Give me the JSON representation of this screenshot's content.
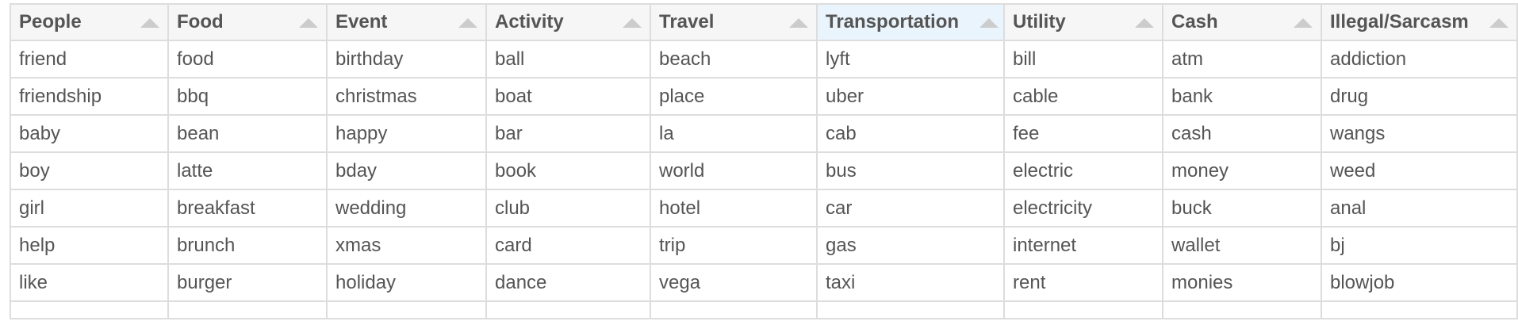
{
  "table": {
    "columns": [
      "People",
      "Food",
      "Event",
      "Activity",
      "Travel",
      "Transportation",
      "Utility",
      "Cash",
      "Illegal/Sarcasm"
    ],
    "active_column": "Transportation",
    "sort_icon": "sort-up-triangle",
    "rows": [
      [
        "friend",
        "food",
        "birthday",
        "ball",
        "beach",
        "lyft",
        "bill",
        "atm",
        "addiction"
      ],
      [
        "friendship",
        "bbq",
        "christmas",
        "boat",
        "place",
        "uber",
        "cable",
        "bank",
        "drug"
      ],
      [
        "baby",
        "bean",
        "happy",
        "bar",
        "la",
        "cab",
        "fee",
        "cash",
        "wangs"
      ],
      [
        "boy",
        "latte",
        "bday",
        "book",
        "world",
        "bus",
        "electric",
        "money",
        "weed"
      ],
      [
        "girl",
        "breakfast",
        "wedding",
        "club",
        "hotel",
        "car",
        "electricity",
        "buck",
        "anal"
      ],
      [
        "help",
        "brunch",
        "xmas",
        "card",
        "trip",
        "gas",
        "internet",
        "wallet",
        "bj"
      ],
      [
        "like",
        "burger",
        "holiday",
        "dance",
        "vega",
        "taxi",
        "rent",
        "monies",
        "blowjob"
      ]
    ]
  }
}
